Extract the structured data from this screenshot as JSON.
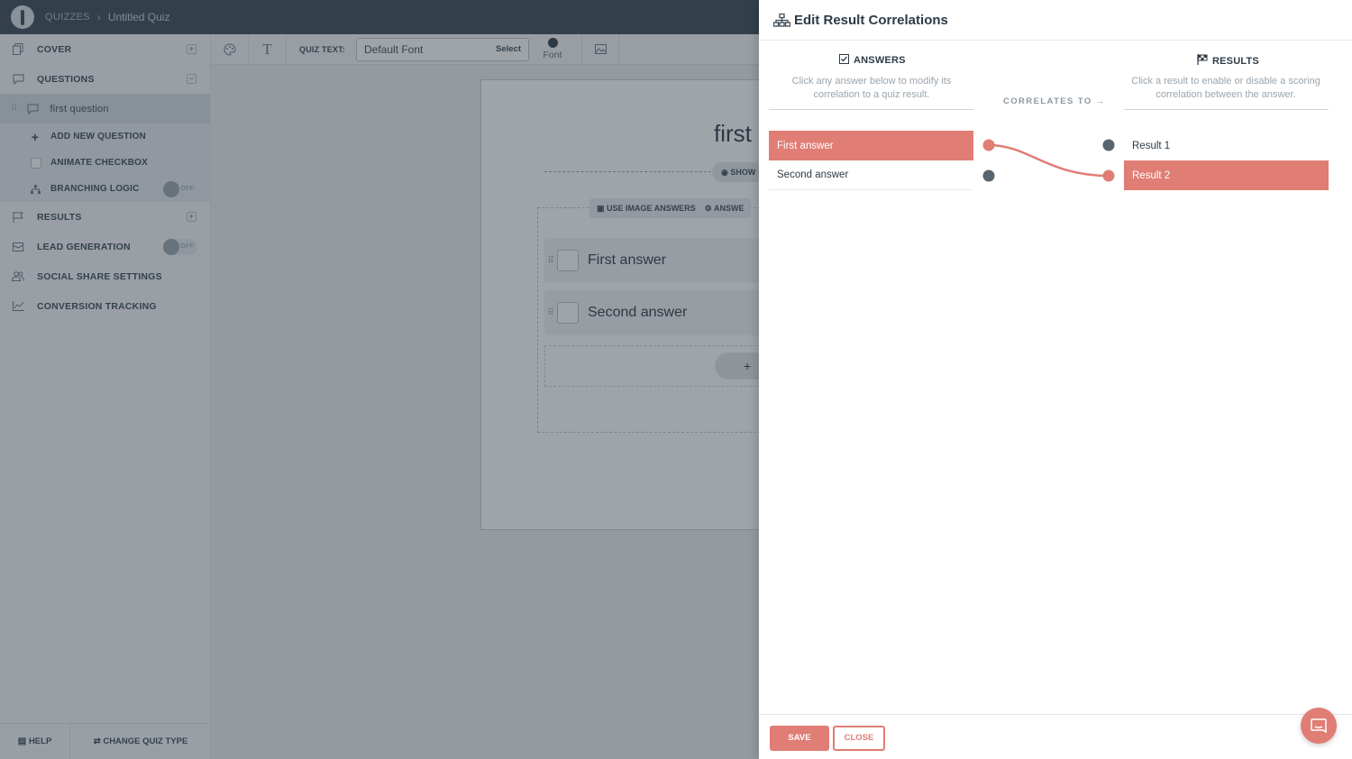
{
  "topbar": {
    "breadcrumb": "QUIZZES",
    "quiz_title": "Untitled Quiz"
  },
  "sidebar": {
    "cover": "COVER",
    "questions": "QUESTIONS",
    "active_question": "first question",
    "add_question": "ADD NEW QUESTION",
    "animate_checkbox": "ANIMATE CHECKBOX",
    "branching_logic": "BRANCHING LOGIC",
    "branching_toggle": "OFF",
    "results": "RESULTS",
    "lead_generation": "LEAD GENERATION",
    "lead_toggle": "OFF",
    "social_share": "SOCIAL SHARE SETTINGS",
    "conversion_tracking": "CONVERSION TRACKING",
    "help": "HELP",
    "change_type": "CHANGE QUIZ TYPE"
  },
  "toolbar": {
    "quiz_text_label": "QUIZ TEXT:",
    "font_value": "Default Font",
    "font_select": "Select",
    "font_color_label": "Font"
  },
  "canvas": {
    "question_title": "first",
    "show_label": "SHOW",
    "use_image_answers": "USE IMAGE ANSWERS",
    "answers_label": "ANSWE",
    "answers": [
      "First answer",
      "Second answer"
    ],
    "add_symbol": "+"
  },
  "panel": {
    "title": "Edit Result Correlations",
    "answers_head": "ANSWERS",
    "answers_desc": "Click any answer below to modify its correlation to a quiz result.",
    "correlates": "CORRELATES TO",
    "results_head": "RESULTS",
    "results_desc": "Click a result to enable or disable a scoring correlation between the answer.",
    "answer_items": [
      "First answer",
      "Second answer"
    ],
    "result_items": [
      "Result 1",
      "Result 2"
    ],
    "save": "SAVE",
    "close": "CLOSE"
  },
  "colors": {
    "accent": "#e07d75",
    "dark": "#3b4a56",
    "node": "#56656f"
  }
}
